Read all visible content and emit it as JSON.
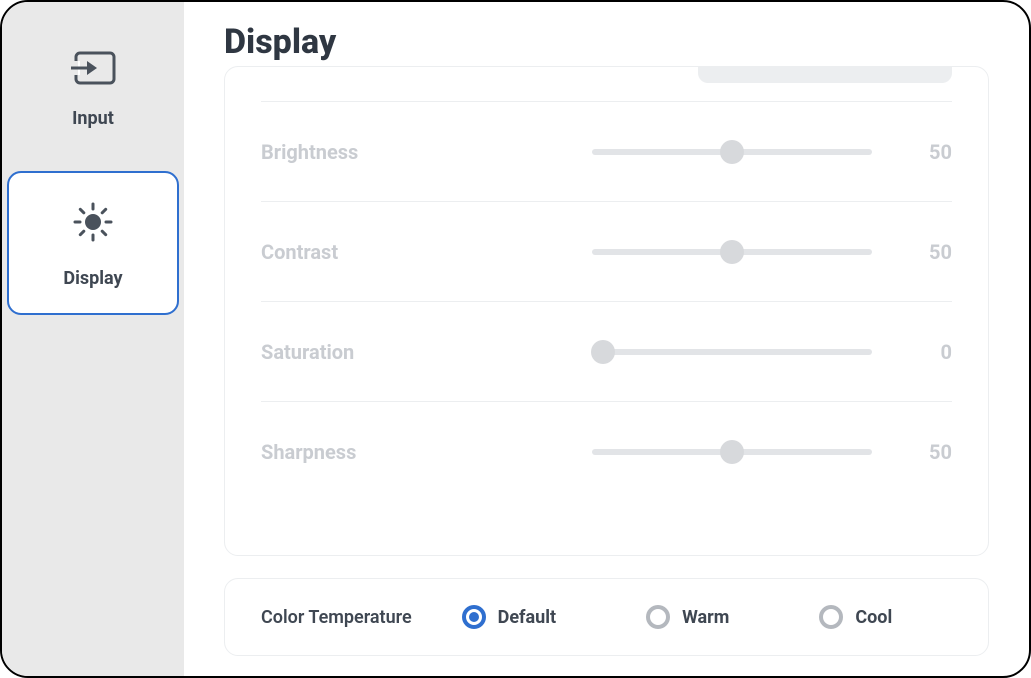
{
  "sidebar": {
    "items": [
      {
        "label": "Input",
        "icon": "input-icon",
        "active": false
      },
      {
        "label": "Display",
        "icon": "brightness-icon",
        "active": true
      }
    ]
  },
  "page": {
    "title": "Display"
  },
  "sliders": [
    {
      "label": "Brightness",
      "value": 50,
      "min": 0,
      "max": 100
    },
    {
      "label": "Contrast",
      "value": 50,
      "min": 0,
      "max": 100
    },
    {
      "label": "Saturation",
      "value": 0,
      "min": 0,
      "max": 100
    },
    {
      "label": "Sharpness",
      "value": 50,
      "min": 0,
      "max": 100
    }
  ],
  "colorTemperature": {
    "label": "Color Temperature",
    "options": [
      {
        "label": "Default",
        "selected": true
      },
      {
        "label": "Warm",
        "selected": false
      },
      {
        "label": "Cool",
        "selected": false
      }
    ]
  },
  "colors": {
    "accent": "#2f6fcf",
    "mutedText": "#c9ccd1",
    "text": "#3f4752"
  }
}
